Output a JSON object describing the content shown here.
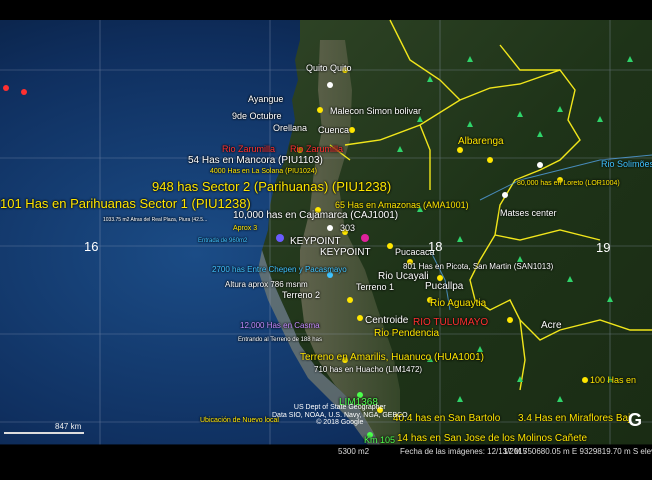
{
  "map": {
    "grid_labels": [
      "16",
      "18",
      "19"
    ],
    "labels": [
      {
        "text": "Quito Quito",
        "color": "#ffffff",
        "size": 9
      },
      {
        "text": "Ayangue",
        "color": "#ffffff",
        "size": 9
      },
      {
        "text": "Malecon Simon bolivar",
        "color": "#ffffff",
        "size": 9
      },
      {
        "text": "9de Octubre",
        "color": "#ffffff",
        "size": 9
      },
      {
        "text": "Orellana",
        "color": "#ffffff",
        "size": 9
      },
      {
        "text": "Cuenca",
        "color": "#ffffff",
        "size": 9
      },
      {
        "text": "Rio Zarumilla",
        "color": "#ff3030",
        "size": 9
      },
      {
        "text": "Rio Zarumilla",
        "color": "#ff3030",
        "size": 9
      },
      {
        "text": "54 Has en Mancora (PIU1103)",
        "color": "#ffffff",
        "size": 10
      },
      {
        "text": "4000 Has en La Solana (PIU1024)",
        "color": "#ffe600",
        "size": 7
      },
      {
        "text": "948 has Sector 2 (Parihuanas) (PIU1238)",
        "color": "#ffe600",
        "size": 13
      },
      {
        "text": "101 Has en Parihuanas Sector 1 (PIU1238)",
        "color": "#ffe600",
        "size": 13
      },
      {
        "text": "1033.75 m2 Atras del Real Plaza, Piura (42.5...",
        "color": "#ffffff",
        "size": 5
      },
      {
        "text": "10,000 has en Cajamarca (CAJ1001)",
        "color": "#ffffff",
        "size": 10
      },
      {
        "text": "65 Has en Amazonas (AMA1001)",
        "color": "#ffe600",
        "size": 9
      },
      {
        "text": "Albarenga",
        "color": "#ffe600",
        "size": 10
      },
      {
        "text": "Rio Solimões",
        "color": "#3fc3ff",
        "size": 9
      },
      {
        "text": "80,000 has en Loreto (LOR1004)",
        "color": "#ffe600",
        "size": 7
      },
      {
        "text": "Matses center",
        "color": "#ffffff",
        "size": 9
      },
      {
        "text": "Aprox 3",
        "color": "#ffe600",
        "size": 7
      },
      {
        "text": "Entrada de 960m2",
        "color": "#3fc3ff",
        "size": 6
      },
      {
        "text": "KEYPOINT",
        "color": "#ffffff",
        "size": 10
      },
      {
        "text": "303",
        "color": "#ffffff",
        "size": 9
      },
      {
        "text": "KEYPOINT",
        "color": "#ffffff",
        "size": 10
      },
      {
        "text": "Pucacaca",
        "color": "#ffffff",
        "size": 9
      },
      {
        "text": "Rio Ucayali",
        "color": "#ffffff",
        "size": 10
      },
      {
        "text": "801 Has en Picota, San Martin (SAN1013)",
        "color": "#ffffff",
        "size": 8
      },
      {
        "text": "Pucallpa",
        "color": "#ffffff",
        "size": 10
      },
      {
        "text": "2700 has Entre Chepen y Pacasmayo",
        "color": "#3fc3ff",
        "size": 8
      },
      {
        "text": "Altura aprox 786 msnm",
        "color": "#ffffff",
        "size": 8
      },
      {
        "text": "Terreno 2",
        "color": "#ffffff",
        "size": 9
      },
      {
        "text": "Terreno 1",
        "color": "#ffffff",
        "size": 9
      },
      {
        "text": "Rio Aguaytia",
        "color": "#ffe600",
        "size": 10
      },
      {
        "text": "Centroide",
        "color": "#ffffff",
        "size": 10
      },
      {
        "text": "RIO TULUMAYO",
        "color": "#ff3030",
        "size": 10
      },
      {
        "text": "Acre",
        "color": "#ffffff",
        "size": 10
      },
      {
        "text": "12,000 Has en Casma",
        "color": "#c58bff",
        "size": 8
      },
      {
        "text": "Rio Pendencia",
        "color": "#ffe600",
        "size": 10
      },
      {
        "text": "Entrando al Terreno de 188 has",
        "color": "#ffffff",
        "size": 6
      },
      {
        "text": "Terreno en Amarilis, Huanuco (HUA1001)",
        "color": "#ffe600",
        "size": 10
      },
      {
        "text": "710 has en Huacho (LIM1472)",
        "color": "#ffffff",
        "size": 8
      },
      {
        "text": "100 Has en",
        "color": "#ffe600",
        "size": 9
      },
      {
        "text": "LIM1368",
        "color": "#4dff4d",
        "size": 10
      },
      {
        "text": "40.4 has en San Bartolo",
        "color": "#ffe600",
        "size": 10
      },
      {
        "text": "3.4 Has en Miraflores Baj",
        "color": "#ffe600",
        "size": 10
      },
      {
        "text": "Ubicación de Nuevo local",
        "color": "#ffe600",
        "size": 7
      },
      {
        "text": "Km 105",
        "color": "#4dff4d",
        "size": 9
      },
      {
        "text": "14 has en San Jose de los Molinos Cañete",
        "color": "#ffe600",
        "size": 10
      }
    ],
    "attribution": [
      "US Dept of State Geographer",
      "Data SIO, NOAA, U.S. Navy, NGA, GEBCO",
      "© 2018 Google"
    ],
    "scale": "847 km",
    "google_logo": "G"
  },
  "status_bar": {
    "left": "5300 m2",
    "imagery_date": "Fecha de las imágenes: 12/13/2015",
    "coords": "17 M 750680.05 m E 9329819.70 m S elev"
  }
}
